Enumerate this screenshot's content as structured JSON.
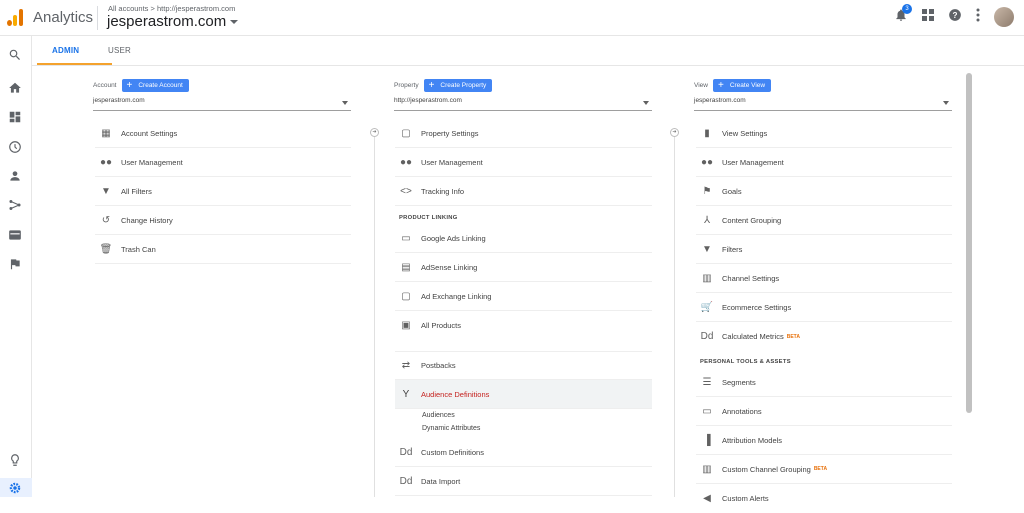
{
  "app": {
    "title": "Analytics",
    "crumb": "All accounts > http://jesperastrom.com",
    "account": "jesperastrom.com",
    "notifications": "3"
  },
  "tabs": {
    "admin": "ADMIN",
    "user": "USER"
  },
  "account_col": {
    "label": "Account",
    "create": "Create Account",
    "selected": "jesperastrom.com",
    "items": [
      "Account Settings",
      "User Management",
      "All Filters",
      "Change History",
      "Trash Can"
    ]
  },
  "property_col": {
    "label": "Property",
    "create": "Create Property",
    "selected": "http://jesperastrom.com",
    "items": [
      "Property Settings",
      "User Management",
      "Tracking Info"
    ],
    "section": "PRODUCT LINKING",
    "linking": [
      "Google Ads Linking",
      "AdSense Linking",
      "Ad Exchange Linking",
      "All Products"
    ],
    "more": [
      "Postbacks",
      "Audience Definitions"
    ],
    "sub": [
      "Audiences",
      "Dynamic Attributes"
    ],
    "tail": [
      "Custom Definitions",
      "Data Import"
    ]
  },
  "view_col": {
    "label": "View",
    "create": "Create View",
    "selected": "jesperastrom.com",
    "items": [
      "View Settings",
      "User Management",
      "Goals",
      "Content Grouping",
      "Filters",
      "Channel Settings",
      "Ecommerce Settings",
      "Calculated Metrics"
    ],
    "beta": "BETA",
    "section": "PERSONAL TOOLS & ASSETS",
    "tools": [
      "Segments",
      "Annotations",
      "Attribution Models",
      "Custom Channel Grouping",
      "Custom Alerts"
    ]
  },
  "colors": {
    "accent": "#1a73e8",
    "highlight_text": "#c5221f",
    "tab_underline": "#f4a22d"
  }
}
